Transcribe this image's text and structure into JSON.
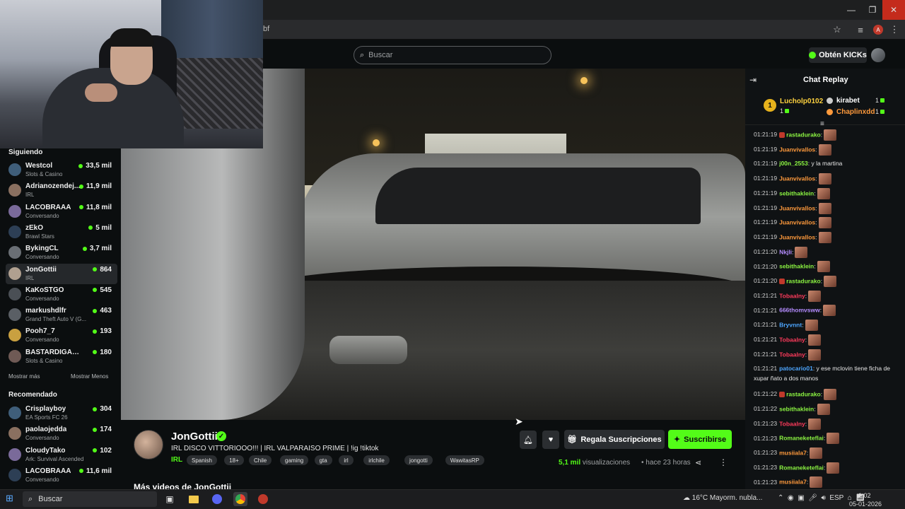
{
  "browser": {
    "url_fragment": "bf",
    "profile_initial": "A"
  },
  "header": {
    "search_placeholder": "Buscar",
    "kicks_label": "Obtén KICKs"
  },
  "sidebar": {
    "following_title": "Siguiendo",
    "following": [
      {
        "name": "Westcol",
        "category": "Slots & Casino",
        "viewers": "33,5 mil"
      },
      {
        "name": "Adrianozendej...",
        "category": "IRL",
        "viewers": "11,9 mil"
      },
      {
        "name": "LACOBRAAA",
        "category": "Conversando",
        "viewers": "11,8 mil"
      },
      {
        "name": "zEkO",
        "category": "Brawl Stars",
        "viewers": "5 mil"
      },
      {
        "name": "BykingCL",
        "category": "Conversando",
        "viewers": "3,7 mil"
      },
      {
        "name": "JonGottii",
        "category": "IRL",
        "viewers": "864"
      },
      {
        "name": "KaKoSTGO",
        "category": "Conversando",
        "viewers": "545"
      },
      {
        "name": "markushdlfr",
        "category": "Grand Theft Auto V (G...",
        "viewers": "463"
      },
      {
        "name": "Pooh7_7",
        "category": "Conversando",
        "viewers": "193"
      },
      {
        "name": "BASTARDIGANGG",
        "category": "Slots & Casino",
        "viewers": "180"
      }
    ],
    "show_more": "Mostrar más",
    "show_less": "Mostrar Menos",
    "recommended_title": "Recomendado",
    "recommended": [
      {
        "name": "Crisplayboy",
        "category": "EA Sports FC 26",
        "viewers": "304"
      },
      {
        "name": "paolaojedda",
        "category": "Conversando",
        "viewers": "174"
      },
      {
        "name": "CloudyTako",
        "category": "Ark: Survival Ascended",
        "viewers": "102"
      },
      {
        "name": "LACOBRAAA",
        "category": "Conversando",
        "viewers": "11,6 mil"
      }
    ]
  },
  "stream": {
    "streamer": "JonGottii",
    "title": "IRL DISCO VITTORIOOO!!! | IRL VALPARAISO PRIME | !ig !tiktok",
    "category": "IRL",
    "tags": [
      "Spanish",
      "18+",
      "Chile",
      "gaming",
      "gta",
      "irl",
      "irlchile",
      "jongotti",
      "WawitasRP"
    ],
    "gift_label": "Regala Suscripciones",
    "subscribe_label": "Suscribirse",
    "views_number": "5,1 mil",
    "views_word": "visualizaciones",
    "time_ago": "hace 23 horas",
    "more_videos": "Más videos de JonGottii"
  },
  "chat": {
    "title": "Chat Replay",
    "leaderboard": [
      {
        "rank": "1",
        "name": "Lucholp0102",
        "count": "1"
      },
      {
        "name": "kirabet",
        "count": "1"
      },
      {
        "name": "Chaplinxdd",
        "count": "1"
      }
    ],
    "messages": [
      {
        "time": "01:21:19",
        "user": "rastadurako",
        "color": "#8cf542",
        "badge": true,
        "text": ":",
        "emote": true
      },
      {
        "time": "01:21:19",
        "user": "Juanvivallos",
        "color": "#ff9a3c",
        "text": ":",
        "emote": true
      },
      {
        "time": "01:21:19",
        "user": "j00n_2553",
        "color": "#8cf542",
        "text": ": y la martina",
        "emote": false
      },
      {
        "time": "01:21:19",
        "user": "Juanvivallos",
        "color": "#ff9a3c",
        "text": ":",
        "emote": true
      },
      {
        "time": "01:21:19",
        "user": "sebithaklein",
        "color": "#8cf542",
        "text": ":",
        "emote": true
      },
      {
        "time": "01:21:19",
        "user": "Juanvivallos",
        "color": "#ff9a3c",
        "text": ":",
        "emote": true
      },
      {
        "time": "01:21:19",
        "user": "Juanvivallos",
        "color": "#ff9a3c",
        "text": ":",
        "emote": true
      },
      {
        "time": "01:21:19",
        "user": "Juanvivallos",
        "color": "#ff9a3c",
        "text": ":",
        "emote": true
      },
      {
        "time": "01:21:20",
        "user": "Nkjli",
        "color": "#b48cff",
        "text": ":",
        "emote": true
      },
      {
        "time": "01:21:20",
        "user": "sebithaklein",
        "color": "#8cf542",
        "text": ":",
        "emote": true
      },
      {
        "time": "01:21:20",
        "user": "rastadurako",
        "color": "#8cf542",
        "badge": true,
        "text": ":",
        "emote": true
      },
      {
        "time": "01:21:21",
        "user": "Tobaalny",
        "color": "#ff3b5c",
        "text": ":",
        "emote": true
      },
      {
        "time": "01:21:21",
        "user": "666thomvsww",
        "color": "#b48cff",
        "text": ":",
        "emote": true
      },
      {
        "time": "01:21:21",
        "user": "Bryvnnt",
        "color": "#4da6ff",
        "text": ":",
        "emote": true
      },
      {
        "time": "01:21:21",
        "user": "Tobaalny",
        "color": "#ff3b5c",
        "text": ":",
        "emote": true
      },
      {
        "time": "01:21:21",
        "user": "Tobaalny",
        "color": "#ff3b5c",
        "text": ":",
        "emote": true
      },
      {
        "time": "01:21:21",
        "user": "patocario01",
        "color": "#4da6ff",
        "text": ": y ese mclovin tiene ficha de xupar ñato a dos manos",
        "emote": false
      },
      {
        "time": "01:21:22",
        "user": "rastadurako",
        "color": "#8cf542",
        "badge": true,
        "text": ":",
        "emote": true
      },
      {
        "time": "01:21:22",
        "user": "sebithaklein",
        "color": "#8cf542",
        "text": ":",
        "emote": true
      },
      {
        "time": "01:21:23",
        "user": "Tobaalny",
        "color": "#ff3b5c",
        "text": ":",
        "emote": true
      },
      {
        "time": "01:21:23",
        "user": "Romaneketeflai",
        "color": "#8cf542",
        "text": ":",
        "emote": true
      },
      {
        "time": "01:21:23",
        "user": "musiiala7",
        "color": "#ff9a3c",
        "text": ":",
        "emote": true
      },
      {
        "time": "01:21:23",
        "user": "Romaneketeflai",
        "color": "#8cf542",
        "text": ":",
        "emote": true
      },
      {
        "time": "01:21:23",
        "user": "musiiala7",
        "color": "#ff9a3c",
        "text": ":",
        "emote": true
      }
    ]
  },
  "taskbar": {
    "search_label": "Buscar",
    "weather": "16°C  Mayorm. nubla...",
    "lang": "ESP",
    "time": "1:02",
    "date": "05-01-2026"
  },
  "colors": {
    "kick_green": "#53fc18",
    "background": "#0b0e0f"
  }
}
